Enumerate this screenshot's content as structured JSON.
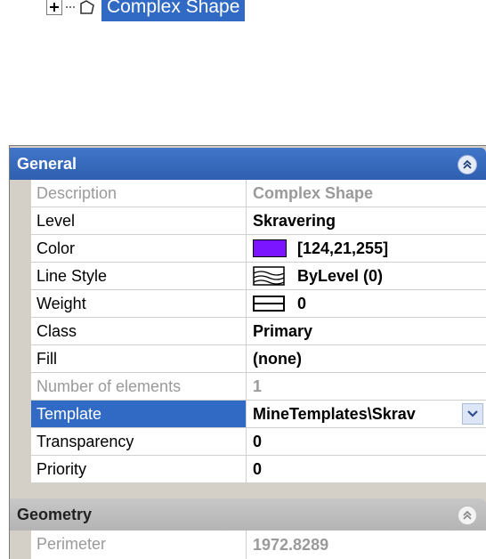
{
  "tree": {
    "label": "Complex Shape"
  },
  "sections": {
    "general": {
      "title": "General",
      "rows": [
        {
          "label": "Description",
          "value": "Complex Shape"
        },
        {
          "label": "Level",
          "value": "Skravering"
        },
        {
          "label": "Color",
          "value": "[124,21,255]",
          "swatch_color": "#7c15ff"
        },
        {
          "label": "Line Style",
          "value": "ByLevel (0)"
        },
        {
          "label": "Weight",
          "value": "0"
        },
        {
          "label": "Class",
          "value": "Primary"
        },
        {
          "label": "Fill",
          "value": "(none)"
        },
        {
          "label": "Number of elements",
          "value": "1"
        },
        {
          "label": "Template",
          "value": "MineTemplates\\Skrav"
        },
        {
          "label": "Transparency",
          "value": "0"
        },
        {
          "label": "Priority",
          "value": "0"
        }
      ]
    },
    "geometry": {
      "title": "Geometry",
      "rows": [
        {
          "label": "Perimeter",
          "value": "1972.8289"
        }
      ]
    }
  },
  "colors": {
    "header_blue": "#2e5fb0",
    "selection_blue": "#316ac5",
    "disabled_text": "#9a9a9a"
  }
}
